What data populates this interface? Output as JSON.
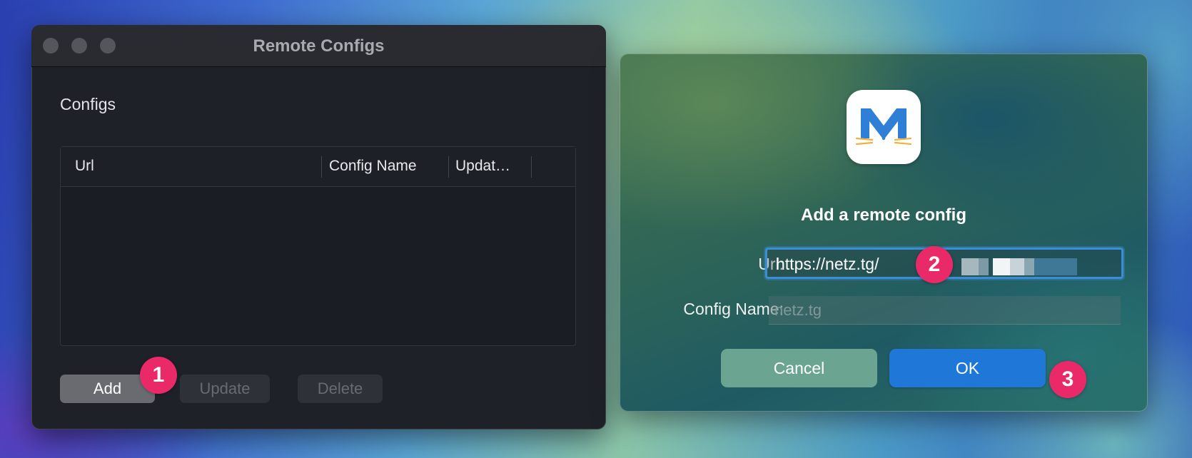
{
  "window": {
    "title": "Remote Configs",
    "section_label": "Configs",
    "table": {
      "columns": [
        "Url",
        "Config Name",
        "Updat…"
      ],
      "rows": []
    },
    "buttons": {
      "add": "Add",
      "update": "Update",
      "delete": "Delete"
    }
  },
  "dialog": {
    "title": "Add a remote config",
    "url_label": "Url:",
    "url_value": "https://netz.tg/",
    "config_name_label": "Config Name:",
    "config_name_placeholder": "netz.tg",
    "cancel_label": "Cancel",
    "ok_label": "OK"
  },
  "annotations": [
    "1",
    "2",
    "3"
  ],
  "colors": {
    "badge": "#ea2a68",
    "ok_button": "#1f78d8",
    "cancel_button": "#6ba591",
    "focus_ring": "#3b8ed6",
    "app_icon_blue": "#2f7fd6",
    "app_icon_whiskers": "#f0b23c"
  }
}
